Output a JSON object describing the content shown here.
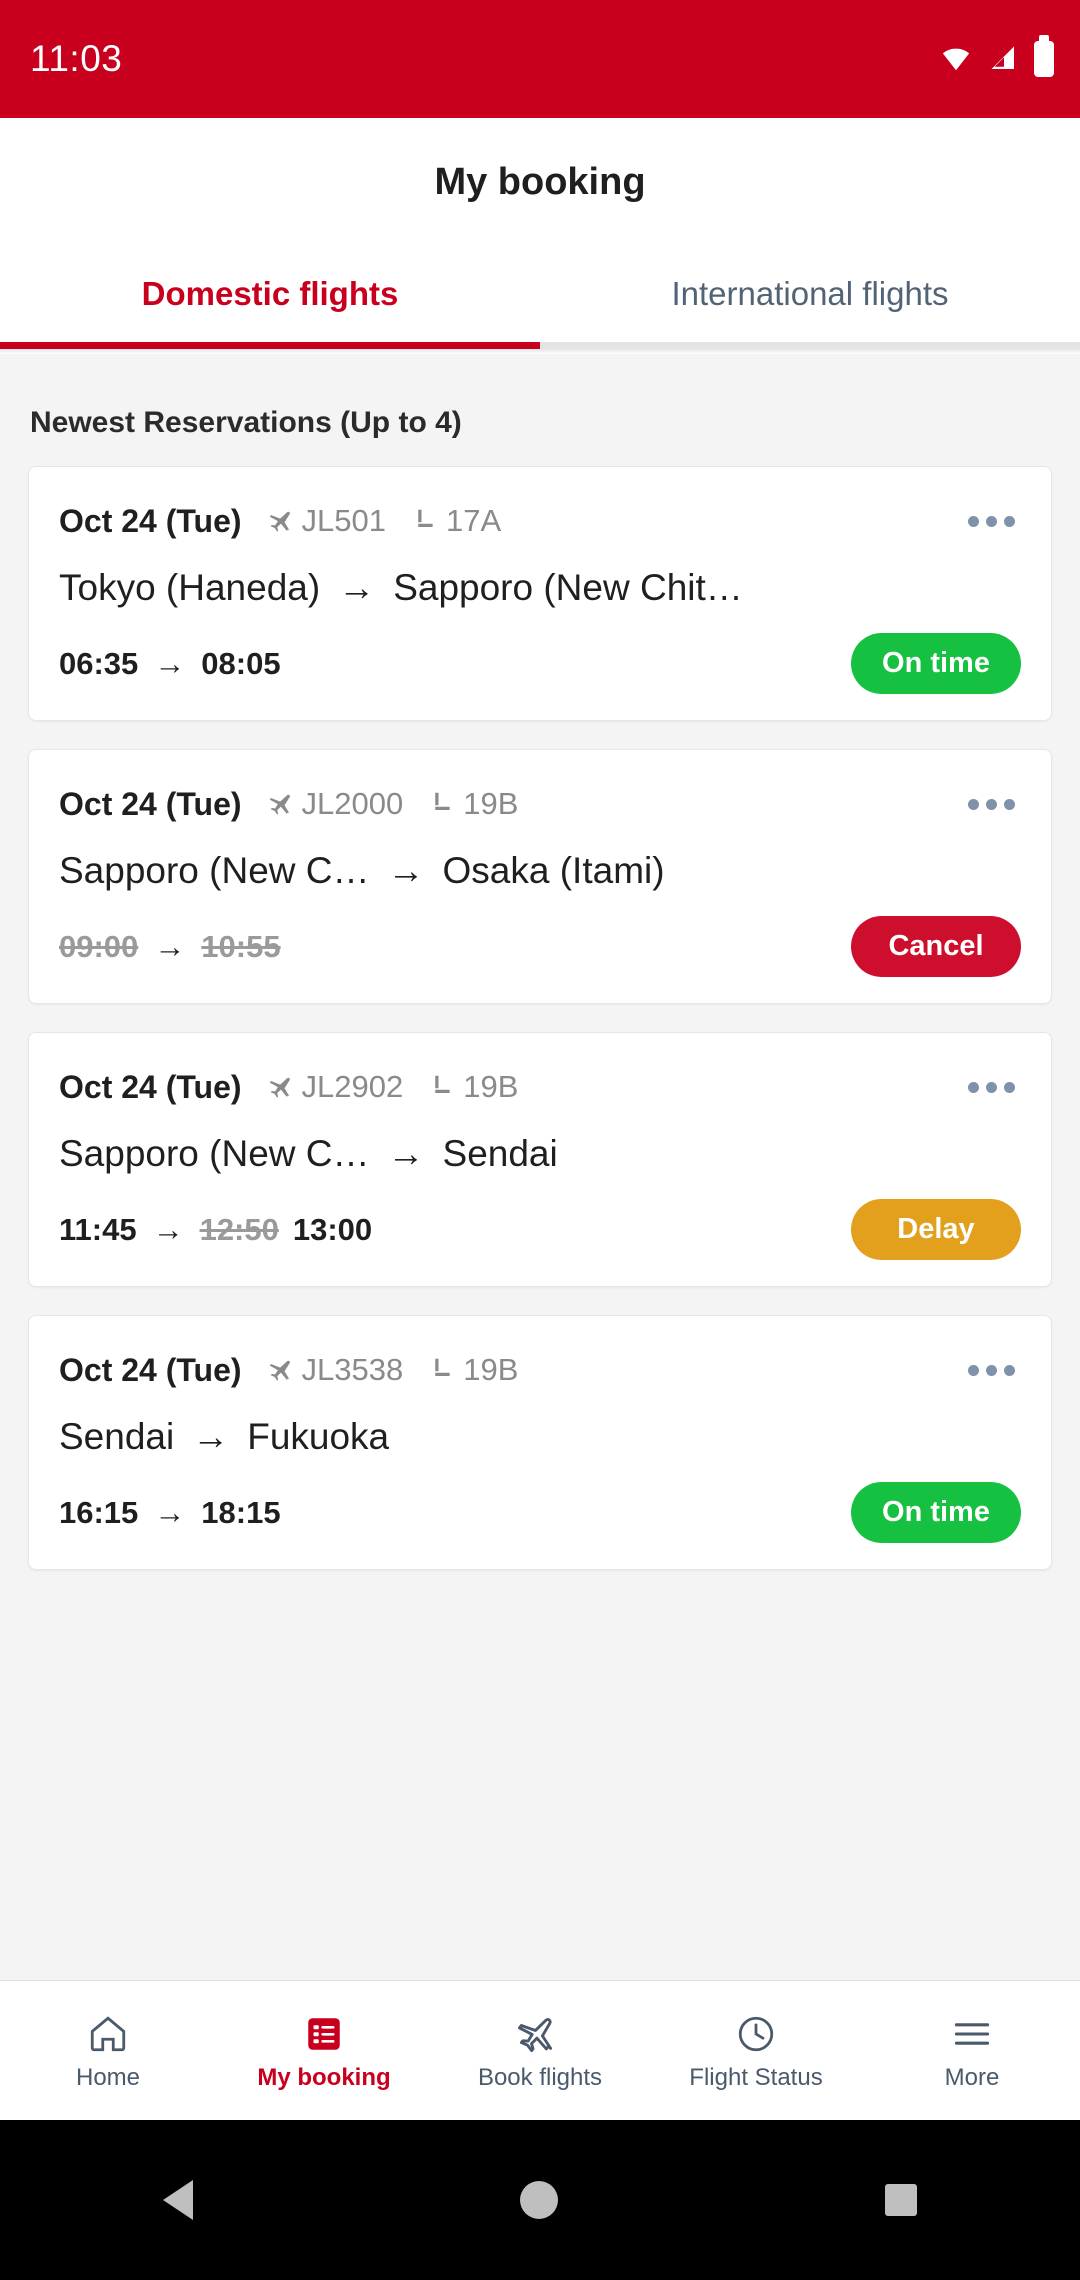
{
  "status_bar": {
    "time": "11:03",
    "icons": [
      "wifi-icon",
      "signal-icon",
      "battery-icon"
    ]
  },
  "app_bar": {
    "title": "My booking"
  },
  "tabs": {
    "items": [
      {
        "label": "Domestic flights",
        "active": true
      },
      {
        "label": "International flights",
        "active": false
      }
    ],
    "indicator_color": "#C8001E"
  },
  "section": {
    "title": "Newest Reservations (Up to 4)"
  },
  "reservations": [
    {
      "date": "Oct 24 (Tue)",
      "flight_icon": "airplane-icon",
      "flight_no": "JL501",
      "seat_icon": "seat-icon",
      "seat": "17A",
      "overflow_icon": "more-options-icon",
      "origin": "Tokyo (Haneda)",
      "arrow": "→",
      "destination": "Sapporo (New Chit…",
      "depart_time": "06:35",
      "arrive_time": "08:05",
      "depart_struck": false,
      "arrive_struck": false,
      "revised_time": "",
      "status_label": "On time",
      "status_kind": "ontime",
      "status_color": "#16C141"
    },
    {
      "date": "Oct 24 (Tue)",
      "flight_icon": "airplane-icon",
      "flight_no": "JL2000",
      "seat_icon": "seat-icon",
      "seat": "19B",
      "overflow_icon": "more-options-icon",
      "origin": "Sapporo (New C…",
      "arrow": "→",
      "destination": "Osaka (Itami)",
      "depart_time": "09:00",
      "arrive_time": "10:55",
      "depart_struck": true,
      "arrive_struck": true,
      "revised_time": "",
      "status_label": "Cancel",
      "status_kind": "cancel",
      "status_color": "#CE0E2D"
    },
    {
      "date": "Oct 24 (Tue)",
      "flight_icon": "airplane-icon",
      "flight_no": "JL2902",
      "seat_icon": "seat-icon",
      "seat": "19B",
      "overflow_icon": "more-options-icon",
      "origin": "Sapporo (New C…",
      "arrow": "→",
      "destination": "Sendai",
      "depart_time": "11:45",
      "arrive_time": "12:50",
      "depart_struck": false,
      "arrive_struck": true,
      "revised_time": "13:00",
      "status_label": "Delay",
      "status_kind": "delay",
      "status_color": "#E3A01C"
    },
    {
      "date": "Oct 24 (Tue)",
      "flight_icon": "airplane-icon",
      "flight_no": "JL3538",
      "seat_icon": "seat-icon",
      "seat": "19B",
      "overflow_icon": "more-options-icon",
      "origin": "Sendai",
      "arrow": "→",
      "destination": "Fukuoka",
      "depart_time": "16:15",
      "arrive_time": "18:15",
      "depart_struck": false,
      "arrive_struck": false,
      "revised_time": "",
      "status_label": "On time",
      "status_kind": "ontime",
      "status_color": "#16C141"
    }
  ],
  "bottom_nav": {
    "items": [
      {
        "label": "Home",
        "icon": "home-icon",
        "active": false
      },
      {
        "label": "My booking",
        "icon": "booking-list-icon",
        "active": true
      },
      {
        "label": "Book flights",
        "icon": "airplane-icon",
        "active": false
      },
      {
        "label": "Flight Status",
        "icon": "clock-icon",
        "active": false
      },
      {
        "label": "More",
        "icon": "hamburger-menu-icon",
        "active": false
      }
    ]
  },
  "system_bar": {
    "back_icon": "back-triangle-icon",
    "home_icon": "home-circle-icon",
    "recents_icon": "recents-square-icon"
  }
}
